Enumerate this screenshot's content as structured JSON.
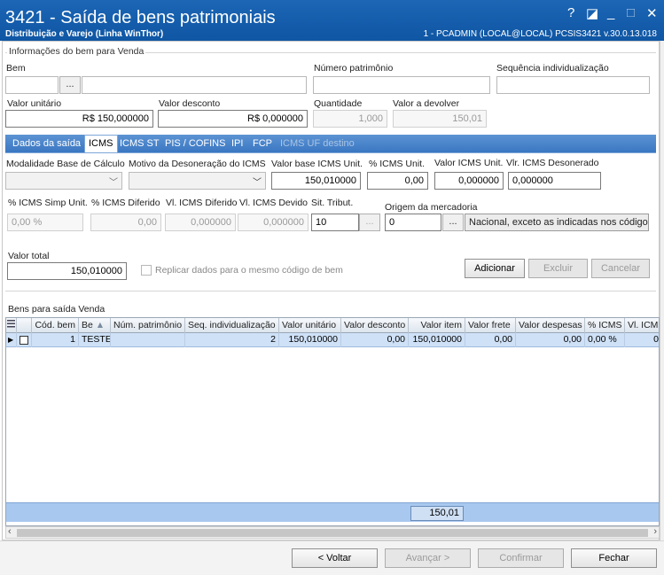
{
  "window": {
    "title": "3421 - Saída de bens patrimoniais",
    "subtitle": "Distribuição e Varejo (Linha WinThor)",
    "user_info": "1 - PCADMIN (LOCAL@LOCAL)   PCSIS3421  v.30.0.13.018",
    "help": "?",
    "restore": "◪",
    "minimize": "_",
    "maximize": "□",
    "close": "✕"
  },
  "info_group": {
    "title": "Informações do bem para Venda",
    "bem_label": "Bem",
    "bem_code": "",
    "bem_desc": "",
    "browse": "...",
    "numero_label": "Número patrimônio",
    "numero_value": "",
    "sequencia_label": "Sequência individualização",
    "sequencia_value": "",
    "valor_unitario_label": "Valor unitário",
    "valor_unitario": "R$ 150,000000",
    "valor_desconto_label": "Valor desconto",
    "valor_desconto": "R$ 0,000000",
    "quantidade_label": "Quantidade",
    "quantidade": "1,000",
    "valor_devolver_label": "Valor a devolver",
    "valor_devolver": "150,01"
  },
  "tabs": [
    {
      "label": "Dados da saída"
    },
    {
      "label": "ICMS"
    },
    {
      "label": "ICMS ST"
    },
    {
      "label": "PIS / COFINS"
    },
    {
      "label": "IPI"
    },
    {
      "label": "FCP"
    },
    {
      "label": "ICMS UF destino"
    }
  ],
  "icms": {
    "modalidade_label": "Modalidade Base de Cálculo",
    "motivo_label": "Motivo da Desoneração do ICMS",
    "valor_base_label": "Valor base ICMS Unit.",
    "valor_base": "150,010000",
    "pct_icms_label": "% ICMS Unit.",
    "pct_icms": "0,00",
    "valor_icms_label": "Valor ICMS Unit.",
    "valor_icms": "0,000000",
    "vlr_deson_label": "Vlr. ICMS Desonerado",
    "vlr_deson": "0,000000",
    "simp_label": "% ICMS Simp Unit.",
    "simp_value": "0,00 %",
    "diferido_pct_label": "% ICMS Diferido",
    "diferido_pct": "0,00",
    "diferido_vl_label": "Vl. ICMS Diferido",
    "diferido_vl": "0,000000",
    "devido_label": "Vl. ICMS Devido",
    "devido": "0,000000",
    "sit_label": "Sit. Tribut.",
    "sit_value": "10",
    "origem_label": "Origem da mercadoria",
    "origem_code": "0",
    "origem_desc": "Nacional, exceto as indicadas nos códigos"
  },
  "totals": {
    "valor_total_label": "Valor total",
    "valor_total": "150,010000",
    "replicar_label": "Replicar dados para o mesmo código de bem",
    "adicionar": "Adicionar",
    "excluir": "Excluir",
    "cancelar": "Cancelar"
  },
  "grid": {
    "title": "Bens para saída Venda",
    "columns": [
      "Cód. bem",
      "Be",
      "Núm. patrimônio",
      "Seq. individualização",
      "Valor unitário",
      "Valor desconto",
      "Valor item",
      "Valor frete",
      "Valor despesas",
      "% ICMS",
      "Vl. ICMS"
    ],
    "rows": [
      {
        "cod_bem": "1",
        "bem": "TESTE",
        "num_patrimonio": "",
        "seq": "2",
        "valor_unitario": "150,010000",
        "valor_desconto": "0,00",
        "valor_item": "150,010000",
        "valor_frete": "0,00",
        "valor_despesas": "0,00",
        "pct_icms": "0,00 %",
        "vl_icms": "0"
      }
    ],
    "total": "150,01"
  },
  "footer": {
    "voltar": "< Voltar",
    "avancar": "Avançar >",
    "confirmar": "Confirmar",
    "fechar": "Fechar"
  },
  "colors": {
    "title_bar": "#1c66b5",
    "tab_strip": "#3a77c2",
    "grid_selected": "#cfe1f7",
    "grid_footer": "#a9c8ef"
  }
}
